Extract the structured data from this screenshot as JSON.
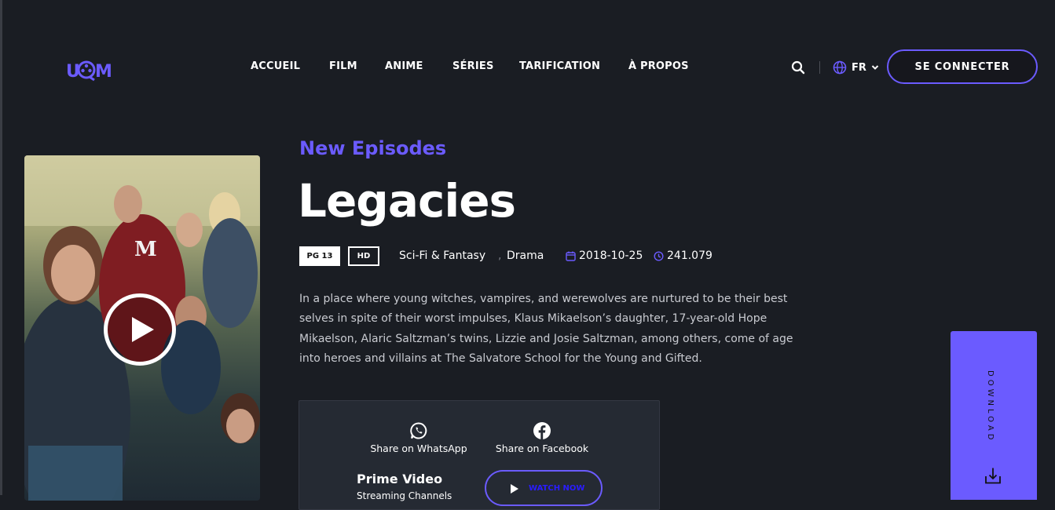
{
  "brand": {
    "logo_text": "UM",
    "accent_color": "#6b5bff"
  },
  "nav": {
    "items": [
      "ACCUEIL",
      "FILM",
      "ANIME",
      "SÉRIES",
      "TARIFICATION",
      "À PROPOS"
    ]
  },
  "header": {
    "search_icon": "search-icon",
    "language": "FR",
    "signin_label": "SE CONNECTER"
  },
  "show": {
    "eyebrow": "New Episodes",
    "title": "Legacies",
    "rating": "PG 13",
    "quality": "HD",
    "genres": [
      "Sci-Fi & Fantasy",
      "Drama"
    ],
    "genre_separator": ",",
    "release_date": "2018-10-25",
    "popularity": "241.079",
    "description": "In a place where young witches, vampires, and werewolves are nurtured to be their best selves in spite of their worst impulses, Klaus Mikaelson’s daughter, 17-year-old Hope Mikaelson, Alaric Saltzman’s twins, Lizzie and Josie Saltzman, among others, come of age into heroes and villains at The Salvatore School for the Young and Gifted."
  },
  "share": {
    "whatsapp_label": "Share on WhatsApp",
    "facebook_label": "Share on Facebook",
    "provider_name": "Prime Video",
    "provider_sub": "Streaming Channels",
    "watch_label": "WATCH NOW"
  },
  "download": {
    "label": "DOWNLOAD"
  }
}
